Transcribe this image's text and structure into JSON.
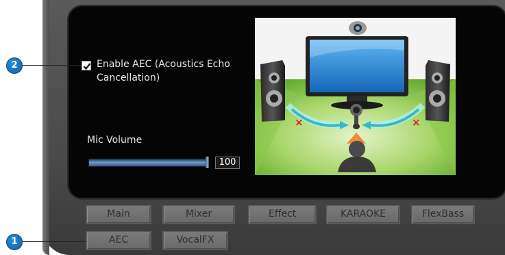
{
  "aec": {
    "checkbox_checked": true,
    "label": "Enable AEC (Acoustics Echo Cancellation)"
  },
  "mic": {
    "label": "Mic Volume",
    "value": "100"
  },
  "illustration": {
    "icon": "aec-diagram"
  },
  "tabs": {
    "row1": [
      "Main",
      "Mixer",
      "Effect",
      "KARAOKE",
      "FlexBass"
    ],
    "row2": [
      "AEC",
      "VocalFX"
    ]
  },
  "callouts": {
    "one": "1",
    "two": "2"
  },
  "colors": {
    "panel": "#000000",
    "tab": "#6e6e6e",
    "callout": "#1a7cc8",
    "green": "#7ec23a"
  }
}
